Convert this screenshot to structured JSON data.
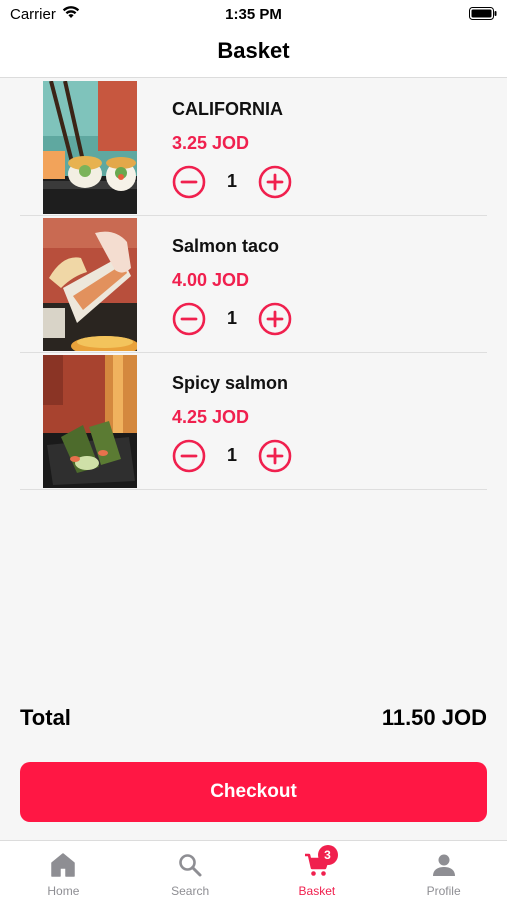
{
  "status_bar": {
    "carrier": "Carrier",
    "time": "1:35 PM"
  },
  "nav": {
    "title": "Basket"
  },
  "colors": {
    "accent": "#f0204e",
    "checkout": "#ff1744",
    "inactive": "#8e8e93"
  },
  "items": [
    {
      "name": "CALIFORNIA",
      "price": "3.25 JOD",
      "quantity": "1"
    },
    {
      "name": "Salmon taco",
      "price": "4.00 JOD",
      "quantity": "1"
    },
    {
      "name": "Spicy salmon",
      "price": "4.25 JOD",
      "quantity": "1"
    }
  ],
  "total": {
    "label": "Total",
    "amount": "11.50 JOD"
  },
  "checkout": {
    "label": "Checkout"
  },
  "tabs": [
    {
      "label": "Home",
      "icon": "home-icon"
    },
    {
      "label": "Search",
      "icon": "search-icon"
    },
    {
      "label": "Basket",
      "icon": "cart-icon",
      "badge": "3",
      "active": true
    },
    {
      "label": "Profile",
      "icon": "person-icon"
    }
  ]
}
